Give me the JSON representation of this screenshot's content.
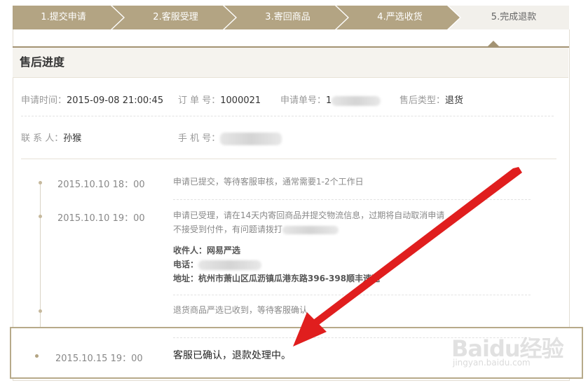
{
  "steps": [
    {
      "label": "1.提交申请",
      "state": "done"
    },
    {
      "label": "2.客服受理",
      "state": "done"
    },
    {
      "label": "3.寄回商品",
      "state": "done"
    },
    {
      "label": "4.严选收货",
      "state": "done"
    },
    {
      "label": "5.完成退款",
      "state": "todo"
    }
  ],
  "colors": {
    "step_done": "#b3a483",
    "step_todo": "#f2f0eb",
    "accent": "#a39373",
    "arrow": "#e01e1e"
  },
  "section": {
    "title": "售后进度"
  },
  "info": {
    "apply_time_label": "申请时间：",
    "apply_time": "2015-09-08  21:00:45",
    "order_no_label": "订 单 号：",
    "order_no": "1000021",
    "apply_no_label": "申请单号：",
    "apply_no_visible": "1",
    "type_label": "售后类型：",
    "type": "退货",
    "contact_label": "联 系 人：",
    "contact": "孙猴",
    "phone_label": "手 机 号："
  },
  "timeline": [
    {
      "time": "2015.10.10  18：00",
      "text": "申请已提交，等待客服审核，通常需要1-2个工作日"
    },
    {
      "time": "2015.10.10  19：00",
      "line1": "申请已受理，请在14天内寄回商品并提交物流信息，过期将自动取消申请",
      "line2": "不接受到付件，有问题请拨打",
      "receiver": "收件人：网易严选",
      "phone": "电话：",
      "address": "地址：杭州市萧山区瓜沥镇瓜港东路396-398顺丰速运"
    },
    {
      "time": "",
      "text": "退货商品严选已收到，等待客服确认"
    },
    {
      "time": "2015.10.15  19：00",
      "text": "客服已确认，退款处理中。"
    }
  ],
  "watermark": {
    "brand": "Baidu经验",
    "sub": "jingyan.baidu.com"
  }
}
